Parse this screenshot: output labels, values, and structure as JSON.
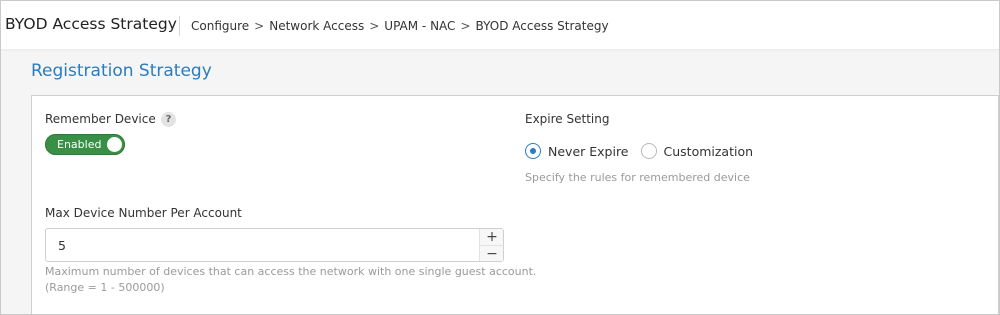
{
  "header": {
    "title": "BYOD Access Strategy",
    "breadcrumb": [
      "Configure",
      "Network Access",
      "UPAM - NAC",
      "BYOD Access Strategy"
    ],
    "separator": ">"
  },
  "section": {
    "title": "Registration Strategy"
  },
  "remember_device": {
    "label": "Remember Device",
    "help_icon": "?",
    "toggle_label": "Enabled",
    "enabled": true
  },
  "expire_setting": {
    "label": "Expire Setting",
    "options": [
      "Never Expire",
      "Customization"
    ],
    "selected": "Never Expire",
    "hint": "Specify the rules for remembered device"
  },
  "max_device": {
    "label": "Max Device Number Per Account",
    "value": "5",
    "increment": "+",
    "decrement": "−",
    "hint_line1": "Maximum number of devices that can access the network with one single guest account.",
    "hint_line2": "(Range = 1 - 500000)"
  },
  "colors": {
    "accent": "#2b7bc0",
    "toggle_on": "#3a8f46"
  }
}
